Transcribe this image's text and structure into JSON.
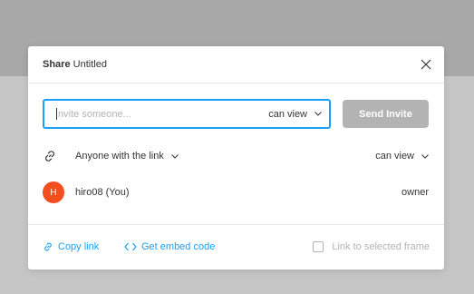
{
  "dialog": {
    "title_bold": "Share",
    "title_rest": " Untitled",
    "close_icon": "close-icon"
  },
  "invite": {
    "placeholder": "Invite someone...",
    "permission": "can view",
    "send_label": "Send Invite"
  },
  "link_access": {
    "icon": "link-icon",
    "label": "Anyone with the link",
    "permission": "can view"
  },
  "members": [
    {
      "initial": "H",
      "name": "hiro08 (You)",
      "role": "owner",
      "avatar_color": "#f24e1e"
    }
  ],
  "footer": {
    "copy_link": "Copy link",
    "embed_code": "Get embed code",
    "link_frame_label": "Link to selected frame",
    "link_frame_checked": false
  },
  "colors": {
    "accent": "#18a0fb",
    "disabled": "#b3b3b3"
  }
}
